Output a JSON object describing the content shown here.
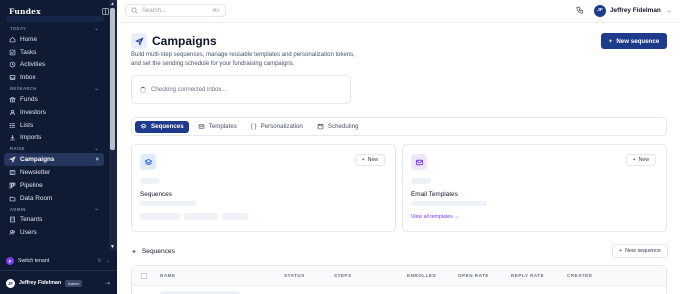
{
  "sidebar": {
    "brand": "Fundex",
    "sections": [
      {
        "title": "TODAY",
        "items": [
          {
            "label": "Home",
            "icon": "home-icon"
          },
          {
            "label": "Tasks",
            "icon": "tasks-icon"
          },
          {
            "label": "Activities",
            "icon": "activities-icon"
          },
          {
            "label": "Inbox",
            "icon": "inbox-icon"
          }
        ]
      },
      {
        "title": "RESEARCH",
        "items": [
          {
            "label": "Funds",
            "icon": "funds-icon"
          },
          {
            "label": "Investors",
            "icon": "investors-icon"
          },
          {
            "label": "Lists",
            "icon": "lists-icon"
          },
          {
            "label": "Imports",
            "icon": "imports-icon"
          }
        ]
      },
      {
        "title": "RAISE",
        "items": [
          {
            "label": "Campaigns",
            "icon": "send-icon",
            "active": true
          },
          {
            "label": "Newsletter",
            "icon": "newsletter-icon"
          },
          {
            "label": "Pipeline",
            "icon": "pipeline-icon"
          },
          {
            "label": "Data Room",
            "icon": "data-room-icon"
          }
        ]
      },
      {
        "title": "ADMIN",
        "items": [
          {
            "label": "Tenants",
            "icon": "tenants-icon"
          },
          {
            "label": "Users",
            "icon": "users-icon"
          }
        ]
      }
    ],
    "switch_tenant": {
      "avatar": "F",
      "label": "Switch tenant"
    },
    "user": {
      "initials": "JF",
      "name": "Jeffrey Fidelman",
      "badge": "Admin"
    }
  },
  "topbar": {
    "search_placeholder": "Search...",
    "search_shortcut": "⌘+",
    "user": {
      "initials": "JF",
      "name": "Jeffrey Fidelman"
    }
  },
  "main": {
    "title": "Campaigns",
    "description": "Build multi-step sequences, manage reusable templates and personalization tokens, and set the sending schedule for your fundraising campaigns.",
    "new_sequence_button": "New sequence",
    "inbox_status": "Checking connected inbox...",
    "tabs": [
      {
        "label": "Sequences",
        "active": true
      },
      {
        "label": "Templates"
      },
      {
        "label": "Personalization"
      },
      {
        "label": "Scheduling"
      }
    ],
    "cards": [
      {
        "title": "Sequences",
        "new_label": "New"
      },
      {
        "title": "Email Templates",
        "new_label": "New",
        "link": "View all templates →"
      }
    ],
    "sequences_section": {
      "title": "Sequences",
      "new_button": "New sequence",
      "columns": [
        "NAME",
        "STATUS",
        "STEPS",
        "ENROLLED",
        "OPEN RATE",
        "REPLY RATE",
        "CREATED"
      ]
    }
  },
  "colors": {
    "sidebar_bg": "#0f1b33",
    "primary": "#1e3a8a",
    "accent_purple": "#7c3aed"
  }
}
